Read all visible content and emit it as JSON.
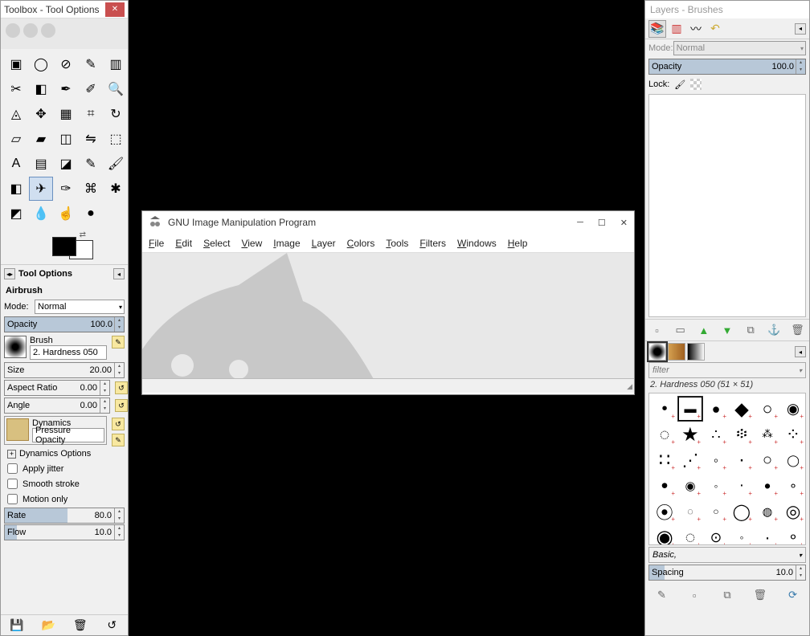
{
  "toolbox": {
    "title": "Toolbox - Tool Options",
    "close": "✕",
    "tools": [
      {
        "n": "rect-select-icon",
        "g": "▣"
      },
      {
        "n": "ellipse-select-icon",
        "g": "◯"
      },
      {
        "n": "free-select-icon",
        "g": "⊘"
      },
      {
        "n": "fuzzy-select-icon",
        "g": "✎"
      },
      {
        "n": "color-select-icon",
        "g": "▥"
      },
      {
        "n": "scissors-icon",
        "g": "✂"
      },
      {
        "n": "fg-select-icon",
        "g": "◧"
      },
      {
        "n": "paths-icon",
        "g": "✒"
      },
      {
        "n": "color-picker-icon",
        "g": "✐"
      },
      {
        "n": "zoom-icon",
        "g": "🔍"
      },
      {
        "n": "measure-icon",
        "g": "◬"
      },
      {
        "n": "move-icon",
        "g": "✥"
      },
      {
        "n": "align-icon",
        "g": "▦"
      },
      {
        "n": "crop-icon",
        "g": "⌗"
      },
      {
        "n": "rotate-icon",
        "g": "↻"
      },
      {
        "n": "scale-icon",
        "g": "▱"
      },
      {
        "n": "shear-icon",
        "g": "▰"
      },
      {
        "n": "perspective-icon",
        "g": "◫"
      },
      {
        "n": "flip-icon",
        "g": "⇋"
      },
      {
        "n": "cage-icon",
        "g": "⬚"
      },
      {
        "n": "text-icon",
        "g": "A"
      },
      {
        "n": "bucket-icon",
        "g": "▤"
      },
      {
        "n": "blend-icon",
        "g": "◪"
      },
      {
        "n": "pencil-icon",
        "g": "✎"
      },
      {
        "n": "paintbrush-icon",
        "g": "🖌"
      },
      {
        "n": "eraser-icon",
        "g": "◧"
      },
      {
        "n": "airbrush-icon",
        "g": "✈"
      },
      {
        "n": "ink-icon",
        "g": "✑"
      },
      {
        "n": "clone-icon",
        "g": "⌘"
      },
      {
        "n": "heal-icon",
        "g": "✱"
      },
      {
        "n": "perspective-clone-icon",
        "g": "◩"
      },
      {
        "n": "blur-icon",
        "g": "💧"
      },
      {
        "n": "smudge-icon",
        "g": "☝"
      },
      {
        "n": "dodge-icon",
        "g": "●"
      }
    ],
    "active_tool_index": 26,
    "tool_options_label": "Tool Options",
    "current_tool": "Airbrush",
    "mode_label": "Mode:",
    "mode_value": "Normal",
    "opacity_label": "Opacity",
    "opacity_value": "100.0",
    "brush_label": "Brush",
    "brush_name": "2. Hardness 050",
    "size_label": "Size",
    "size_value": "20.00",
    "aspect_label": "Aspect Ratio",
    "aspect_value": "0.00",
    "angle_label": "Angle",
    "angle_value": "0.00",
    "dynamics_label": "Dynamics",
    "dynamics_value": "Pressure Opacity",
    "dynamics_options": "Dynamics Options",
    "apply_jitter": "Apply jitter",
    "smooth_stroke": "Smooth stroke",
    "motion_only": "Motion only",
    "rate_label": "Rate",
    "rate_value": "80.0",
    "flow_label": "Flow",
    "flow_value": "10.0"
  },
  "gimp": {
    "title": "GNU Image Manipulation Program",
    "menu": [
      "File",
      "Edit",
      "Select",
      "View",
      "Image",
      "Layer",
      "Colors",
      "Tools",
      "Filters",
      "Windows",
      "Help"
    ]
  },
  "layers": {
    "title": "Layers - Brushes",
    "mode_label": "Mode:",
    "mode_value": "Normal",
    "opacity_label": "Opacity",
    "opacity_value": "100.0",
    "lock_label": "Lock:",
    "filter_placeholder": "filter",
    "brush_info": "2. Hardness 050 (51 × 51)",
    "brush_category": "Basic,",
    "spacing_label": "Spacing",
    "spacing_value": "10.0"
  }
}
